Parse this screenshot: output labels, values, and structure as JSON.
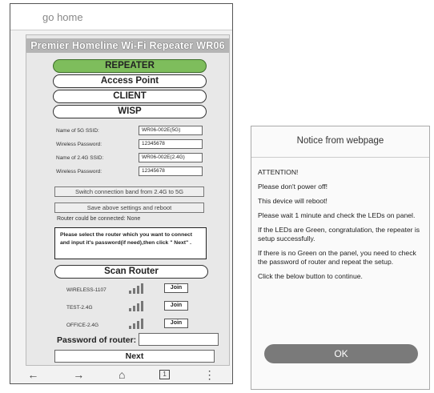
{
  "browser": {
    "address_text": "go home"
  },
  "page": {
    "title": "Premier Homeline Wi-Fi Repeater WR06",
    "modes": [
      "REPEATER",
      "Access Point",
      "CLIENT",
      "WISP"
    ],
    "active_mode": "REPEATER",
    "fields": {
      "ssid_5g_label": "Name of 5G SSID:",
      "ssid_5g_value": "WR06-002E(5G)",
      "pw_5g_label": "Wireless Password:",
      "pw_5g_value": "12345678",
      "ssid_24g_label": "Name of 2.4G SSID:",
      "ssid_24g_value": "WR06-002E(2.4G)",
      "pw_24g_label": "Wireless Password:",
      "pw_24g_value": "12345678"
    },
    "switch_band_label": "Switch connection band from 2.4G to 5G",
    "save_reboot_label": "Save above settings and reboot",
    "router_status": "Router could be connected: None",
    "instruction": "Please select the router which you want to connect and input it's password(if need),then click \" Next\" .",
    "scan_label": "Scan Router",
    "networks": [
      {
        "name": "WIRELESS-1107",
        "join": "Join"
      },
      {
        "name": "TEST-2.4G",
        "join": "Join"
      },
      {
        "name": "OFFICE-2.4G",
        "join": "Join"
      }
    ],
    "password_label": "Password of router:",
    "next_label": "Next"
  },
  "navbar": {
    "back_icon": "arrow-left-icon",
    "back_glyph": "←",
    "forward_icon": "arrow-right-icon",
    "forward_glyph": "→",
    "home_icon": "home-icon",
    "home_glyph": "⌂",
    "tabs_count": "1",
    "menu_glyph": "⋮"
  },
  "dialog": {
    "title": "Notice from webpage",
    "lines": [
      "ATTENTION!",
      "Please don't power off!",
      "This device will reboot!",
      "Please wait 1 minute and check the LEDs on panel.",
      "If the LEDs are Green, congratulation, the repeater is setup successfully.",
      "If there is no Green on the panel, you need to check the password of router and repeat the setup.",
      "Click the below button to continue."
    ],
    "ok_label": "OK"
  },
  "colors": {
    "active_mode": "#7ebd5c",
    "ok_button": "#7a7a7a",
    "title_bar": "#b5b5b5"
  }
}
